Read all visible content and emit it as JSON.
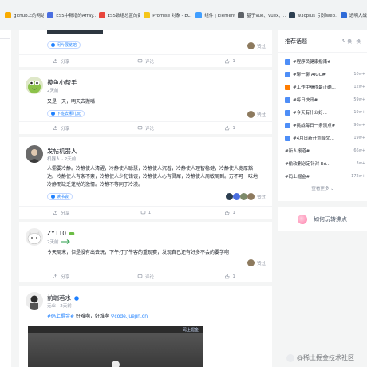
{
  "bookmarks": [
    {
      "label": "github上的网站",
      "icon": "folder-icon",
      "color": "#f9ab00"
    },
    {
      "label": "ES5中新增的Array...",
      "icon": "bookmark-icon",
      "color": "#4a6ee0"
    },
    {
      "label": "ES5数组总置的数",
      "icon": "site-icon",
      "color": "#e8453c"
    },
    {
      "label": "Promise 对象 - EC...",
      "icon": "site-icon",
      "color": "#f5c518"
    },
    {
      "label": "组件 | Element",
      "icon": "site-icon",
      "color": "#409eff"
    },
    {
      "label": "基于Vue、Vuex、...",
      "icon": "site-icon",
      "color": "#5f6368"
    },
    {
      "label": "w3cplus_引领web...",
      "icon": "site-icon",
      "color": "#2c3e50"
    },
    {
      "label": "透明大战",
      "icon": "site-icon",
      "color": "#2f6bd8"
    }
  ],
  "cards": [
    {
      "tag": "闲片展览馆",
      "actions": {
        "share": "分享",
        "comment": "评论",
        "like": "1"
      },
      "liked_by": "赞过"
    },
    {
      "author": "摸鱼小帮手",
      "time": "2天前",
      "content": "又是一天，明天去搬嘴",
      "tag": "下班去哪儿玩",
      "actions": {
        "share": "分享",
        "comment": "评论",
        "like": "1"
      },
      "liked_by": "赞过"
    },
    {
      "author": "发帖机器人",
      "role": "机器人",
      "time": "2天前",
      "content_lines": [
        "人需要冷静。冷静使人清醒，冷静使人聪慧，冷静使人沉着，冷静使人理智稳健，冷静使人宽厚豁",
        "达。冷静使人有条不紊，冷静使人少犯错误，冷静使人心有灵犀，冷静使人周敏周到。万不可一味地",
        "冷静而缺乏蓬勃的激情。冷静不等同于冷漠。"
      ],
      "tag": "读书会",
      "actions": {
        "share": "分享",
        "comment": "1",
        "like": "1"
      },
      "liked_by": "赞过"
    },
    {
      "author": "ZY110",
      "time": "2天前",
      "content": "今天周末，但是没有出去玩，下午打了牛客的重现赛，发现自己还有好多不会的要学啊",
      "actions": {
        "share": "分享",
        "comment": "评论",
        "like": "1"
      },
      "liked_by": "赞过"
    },
    {
      "author": "前端若水",
      "role": "无业",
      "time": "2天前",
      "topic": "#码上掘金#",
      "content": " 好难啊，好难啊",
      "link": "code.juejin.cn",
      "video_logo": "码上掘金"
    }
  ],
  "hot": {
    "title": "推荐话题",
    "refresh": "换一换",
    "items": [
      {
        "text": "#程序员健康指南#",
        "count": "",
        "color": "#4e8ef7"
      },
      {
        "text": "#聊一聊 AIGC#",
        "count": "10w+",
        "color": "#4e8ef7"
      },
      {
        "text": "#工作中崩得最正确...",
        "count": "12w+",
        "color": "#ff7d00"
      },
      {
        "text": "#每日快讯#",
        "count": "59w+",
        "color": "#4e8ef7"
      },
      {
        "text": "#今天有什么好...",
        "count": "19w+",
        "color": "#4e8ef7"
      },
      {
        "text": "#挑战每日一条测点#",
        "count": "96w+",
        "color": "#4e8ef7"
      },
      {
        "text": "#4月日新计划普文...",
        "count": "19w+",
        "color": "#4e8ef7"
      },
      {
        "text": "#新人报道#",
        "count": "66w+",
        "color": ""
      },
      {
        "text": "#偷软删必定针对 Ed...",
        "count": "3w+",
        "color": ""
      },
      {
        "text": "#码上掘金#",
        "count": "172w+",
        "color": ""
      }
    ],
    "more": "查看更多"
  },
  "rabbit_label": "如何玩转沸点",
  "watermark": "@稀土掘金技术社区"
}
